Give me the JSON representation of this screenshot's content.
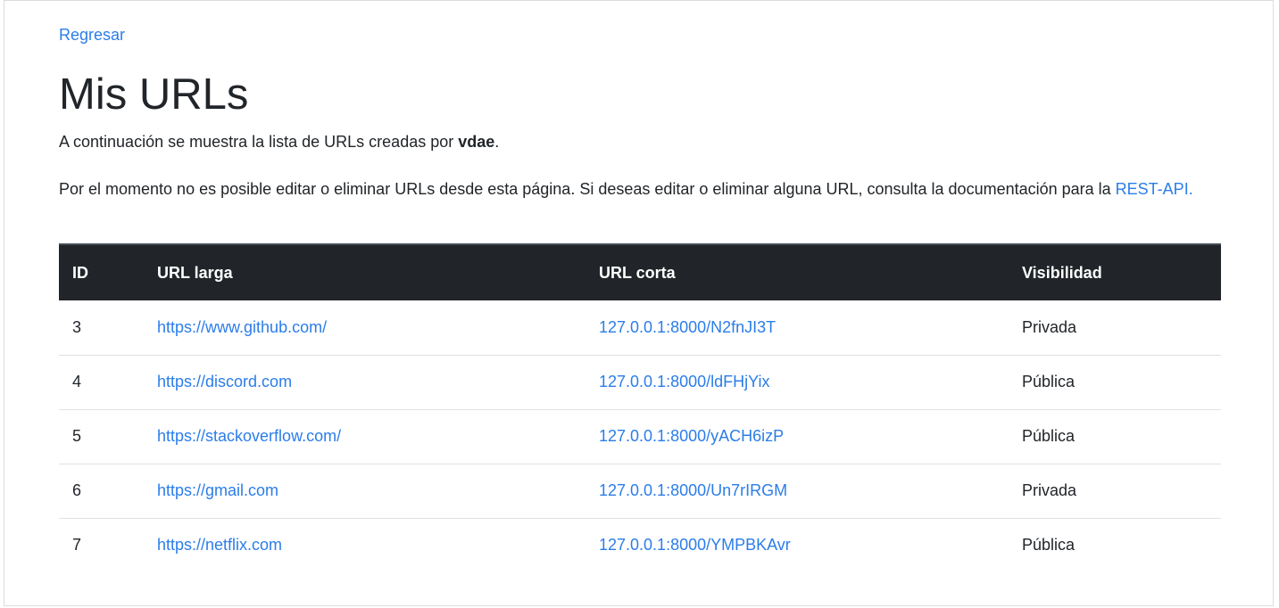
{
  "nav": {
    "back_label": "Regresar"
  },
  "page": {
    "title": "Mis URLs",
    "intro_prefix": "A continuación se muestra la lista de URLs creadas por ",
    "username": "vdae",
    "intro_suffix": ".",
    "notice_text": "Por el momento no es posible editar o eliminar URLs desde esta página. Si deseas editar o eliminar alguna URL, consulta la documentación para la ",
    "notice_link": "REST-API."
  },
  "table": {
    "headers": [
      "ID",
      "URL larga",
      "URL corta",
      "Visibilidad"
    ],
    "rows": [
      {
        "id": "3",
        "long_url": "https://www.github.com/",
        "short_url": "127.0.0.1:8000/N2fnJI3T",
        "visibility": "Privada"
      },
      {
        "id": "4",
        "long_url": "https://discord.com",
        "short_url": "127.0.0.1:8000/ldFHjYix",
        "visibility": "Pública"
      },
      {
        "id": "5",
        "long_url": "https://stackoverflow.com/",
        "short_url": "127.0.0.1:8000/yACH6izP",
        "visibility": "Pública"
      },
      {
        "id": "6",
        "long_url": "https://gmail.com",
        "short_url": "127.0.0.1:8000/Un7rIRGM",
        "visibility": "Privada"
      },
      {
        "id": "7",
        "long_url": "https://netflix.com",
        "short_url": "127.0.0.1:8000/YMPBKAvr",
        "visibility": "Pública"
      }
    ]
  },
  "colors": {
    "link": "#2b7de9",
    "table_header_bg": "#212529",
    "text": "#212529"
  }
}
